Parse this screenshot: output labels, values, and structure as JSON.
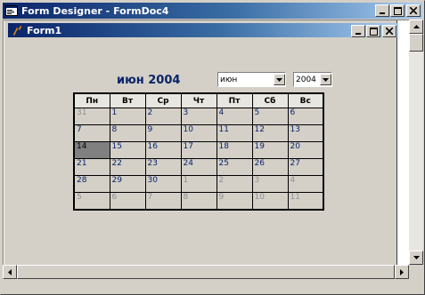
{
  "app": {
    "title": "Form Designer - FormDoc4"
  },
  "form": {
    "title": "Form1"
  },
  "calendar": {
    "header": "июн 2004",
    "month_value": "июн",
    "year_value": "2004",
    "weekdays": [
      "Пн",
      "Вт",
      "Ср",
      "Чт",
      "Пт",
      "Сб",
      "Вс"
    ],
    "weeks": [
      [
        "31",
        "1",
        "2",
        "3",
        "4",
        "5",
        "6"
      ],
      [
        "7",
        "8",
        "9",
        "10",
        "11",
        "12",
        "13"
      ],
      [
        "14",
        "15",
        "16",
        "17",
        "18",
        "19",
        "20"
      ],
      [
        "21",
        "22",
        "23",
        "24",
        "25",
        "26",
        "27"
      ],
      [
        "28",
        "29",
        "30",
        "1",
        "2",
        "3",
        "4"
      ],
      [
        "5",
        "6",
        "7",
        "8",
        "9",
        "10",
        "11"
      ]
    ],
    "selected": "14"
  },
  "colors": {
    "titlebar_start": "#0a246a",
    "titlebar_end": "#a6caf0",
    "day_text": "#0a246a",
    "other_month_text": "#909090",
    "selected_bg": "#808080"
  }
}
